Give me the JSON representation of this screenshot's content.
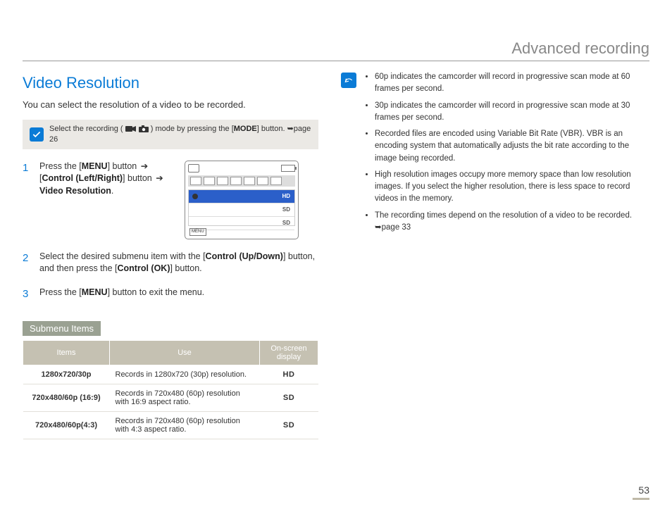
{
  "chapter": "Advanced recording",
  "title": "Video Resolution",
  "intro": "You can select the resolution of a video to be recorded.",
  "graybox": {
    "pre": "Select the recording (",
    "post": ") mode by pressing the [",
    "bold": "MODE",
    "tail": "] button. ",
    "pageref": "➥page 26"
  },
  "steps": [
    {
      "num": "1",
      "a": "Press the [",
      "b": "MENU",
      "c": "] button ",
      "arr": "➔",
      "d": " [",
      "e": "Control (Left/Right)",
      "f": "] button ",
      "arr2": "➔",
      "g": " ",
      "h": "Video Resolution",
      "i": "."
    },
    {
      "num": "2",
      "a": "Select the desired submenu item with the [",
      "b": "Control (Up/Down)",
      "c": "] button, and then press the [",
      "d": "Control (OK)",
      "e": "] button."
    },
    {
      "num": "3",
      "a": "Press the [",
      "b": "MENU",
      "c": "] button to exit the menu."
    }
  ],
  "lcd": {
    "r1": "HD",
    "r2": "SD",
    "r3": "SD",
    "menu": "MENU"
  },
  "submenu_label": "Submenu Items",
  "table": {
    "h1": "Items",
    "h2": "Use",
    "h3": "On-screen display",
    "rows": [
      {
        "item": "1280x720/30p",
        "use": "Records in 1280x720 (30p) resolution.",
        "osd": "HD"
      },
      {
        "item": "720x480/60p (16:9)",
        "use": "Records in 720x480 (60p) resolution with 16:9 aspect ratio.",
        "osd": "SD"
      },
      {
        "item": "720x480/60p(4:3)",
        "use": "Records in 720x480 (60p) resolution with 4:3 aspect ratio.",
        "osd": "SD"
      }
    ]
  },
  "notes": [
    "60p indicates the camcorder will record in progressive scan mode at 60 frames per second.",
    "30p indicates the camcorder will record in progressive scan mode at 30 frames per second.",
    "Recorded files are encoded using Variable Bit Rate (VBR). VBR is an encoding system that automatically adjusts the bit rate according to the image being recorded.",
    "High resolution images occupy more memory space than low resolution images. If you select the higher resolution, there is less space to record videos in the memory.",
    "The recording times depend on the resolution of a video to be recorded. ➥page 33"
  ],
  "page_number": "53"
}
